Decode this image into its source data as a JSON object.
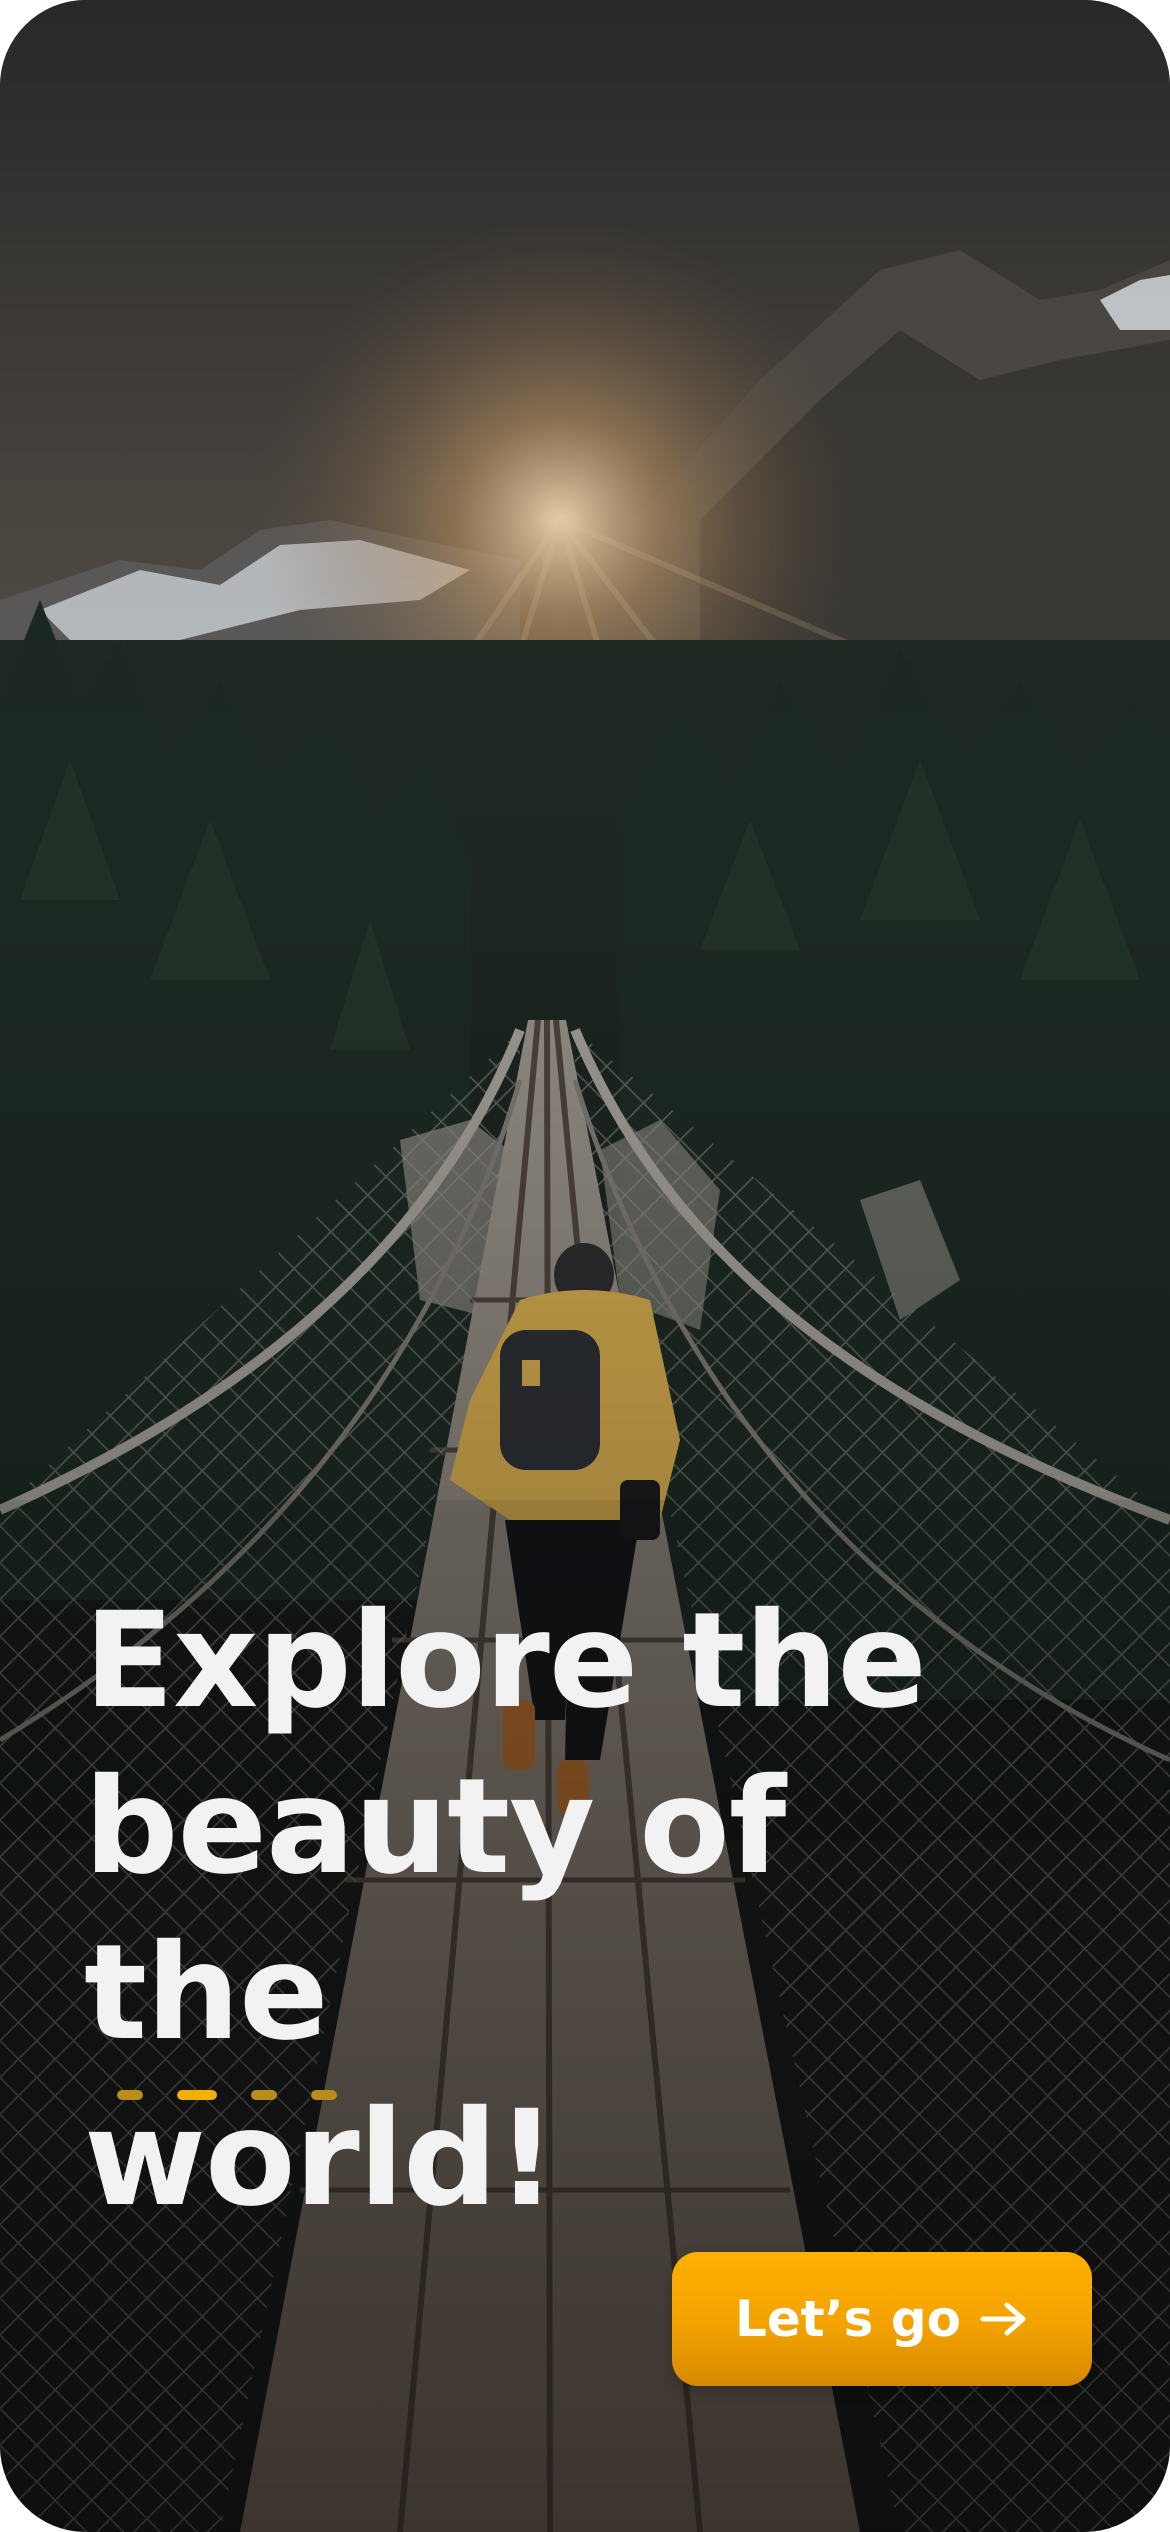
{
  "onboarding": {
    "headline": "Explore the\nbeauty of the\nworld!",
    "pagination": {
      "total": 4,
      "active_index": 1
    },
    "cta": {
      "label": "Let’s go",
      "icon": "arrow-right-icon"
    }
  },
  "colors": {
    "accent": "#F5A700",
    "headline_text": "#F2F2F2",
    "dot_active": "#F2B000",
    "dot_inactive": "#B98D1A"
  },
  "background": {
    "image": "hiker running across a suspension bridge toward forested mountains at sunrise"
  }
}
